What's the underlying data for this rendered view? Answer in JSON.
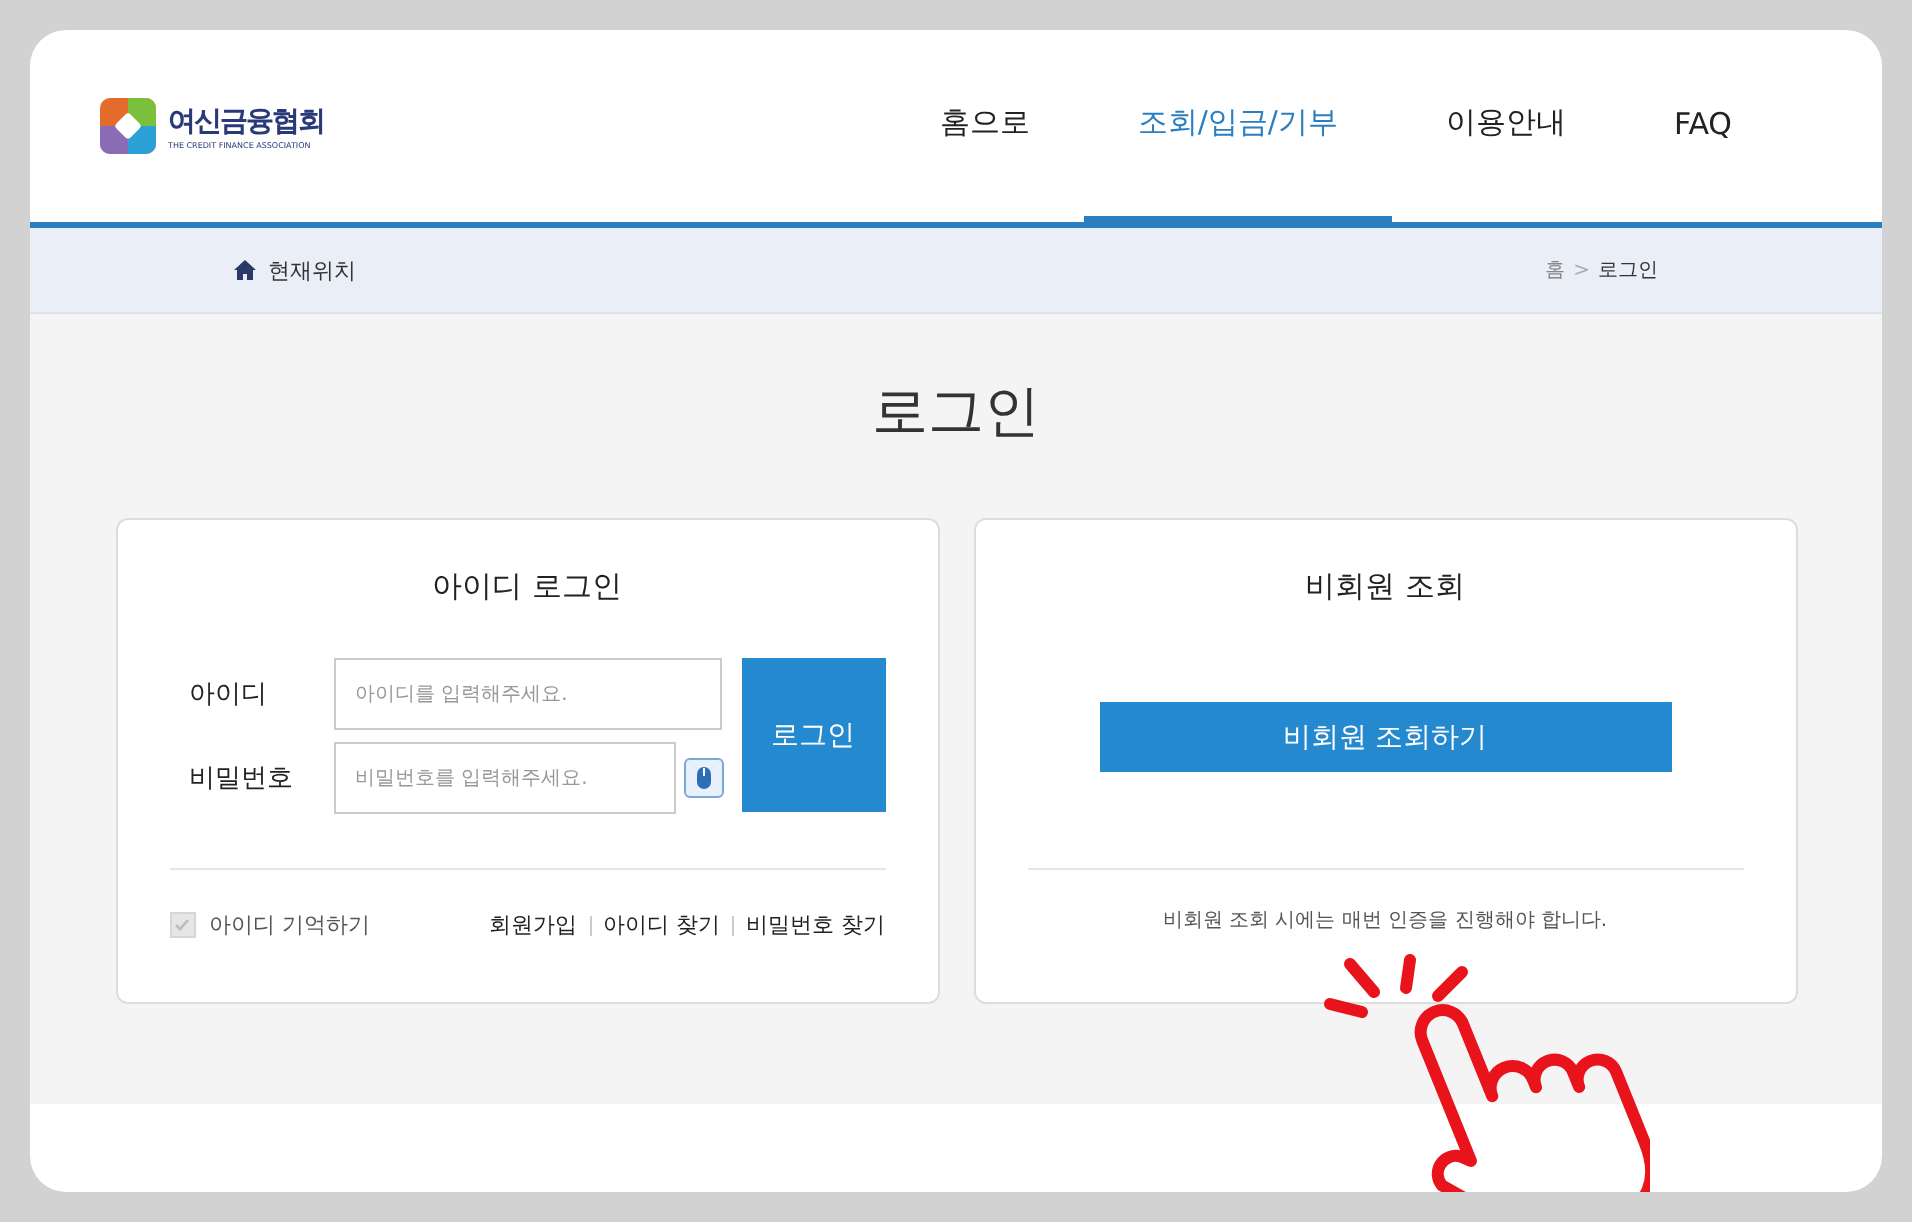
{
  "logo": {
    "name": "여신금융협회",
    "subtitle": "THE CREDIT FINANCE ASSOCIATION"
  },
  "nav": [
    {
      "label": "홈으로",
      "selected": false
    },
    {
      "label": "조회/입금/기부",
      "selected": true
    },
    {
      "label": "이용안내",
      "selected": false
    },
    {
      "label": "FAQ",
      "selected": false
    }
  ],
  "breadcrumb": {
    "label": "현재위치",
    "separator": ">",
    "path": [
      "홈",
      "로그인"
    ]
  },
  "title": "로그인",
  "id_login": {
    "heading": "아이디 로그인",
    "id_label": "아이디",
    "id_placeholder": "아이디를 입력해주세요.",
    "pw_label": "비밀번호",
    "pw_placeholder": "비밀번호를 입력해주세요.",
    "submit": "로그인",
    "remember": {
      "label": "아이디 기억하기",
      "checked": true
    },
    "links": [
      "회원가입",
      "아이디 찾기",
      "비밀번호 찾기"
    ]
  },
  "guest": {
    "heading": "비회원 조회",
    "button": "비회원 조회하기",
    "notice": "비회원 조회 시에는 매번 인증을 진행해야 합니다."
  }
}
